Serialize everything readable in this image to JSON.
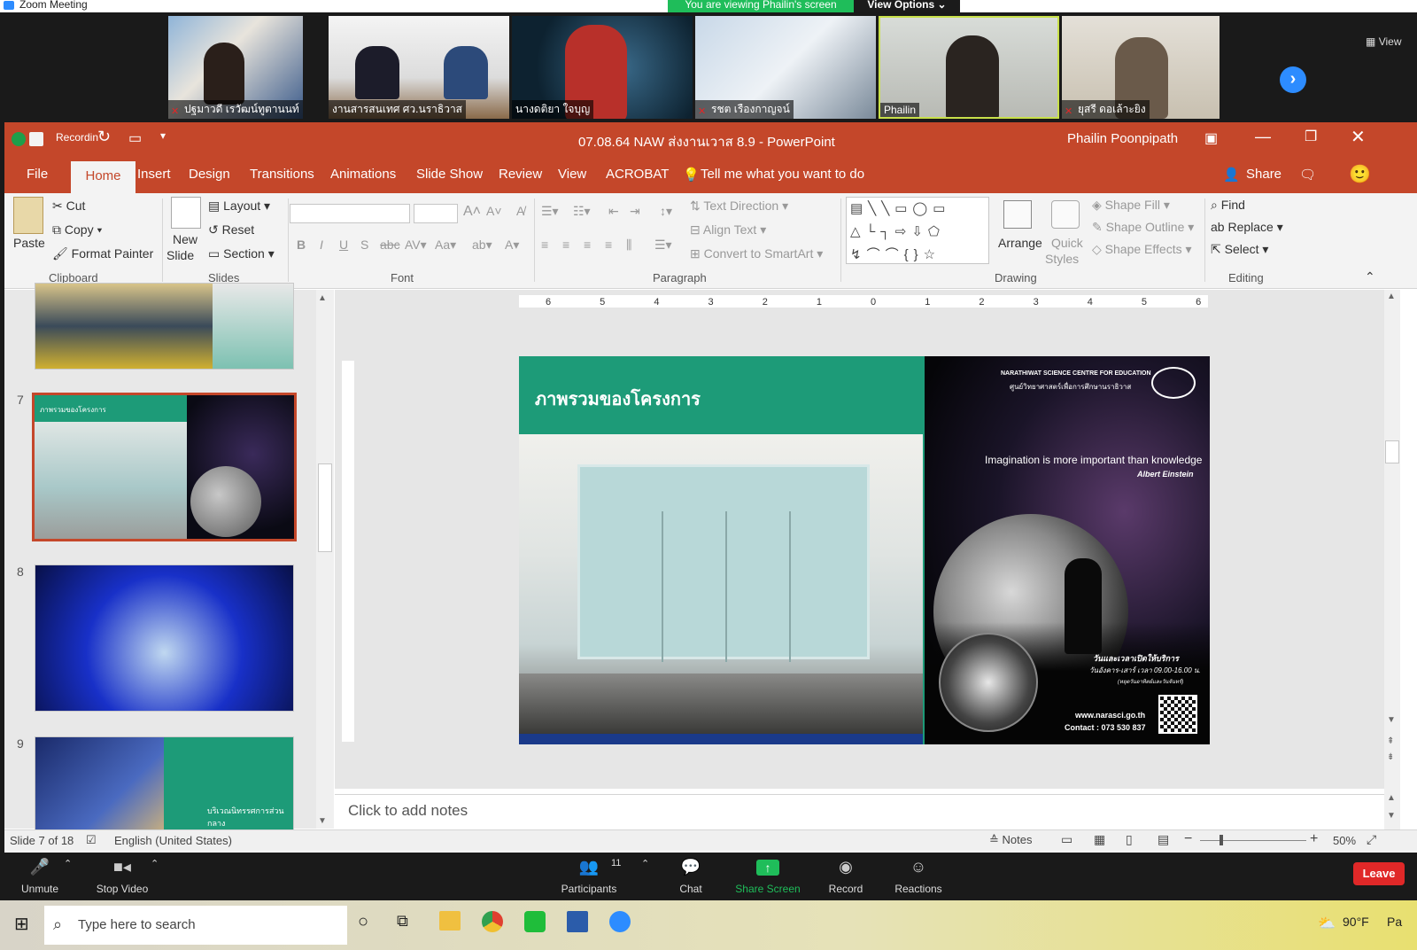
{
  "zoom": {
    "window_title": "Zoom Meeting",
    "viewing_banner": "You are viewing Phailin's screen",
    "view_options": "View Options",
    "view_label": "View",
    "participants": [
      {
        "name": "ปฐมาวดี เรวัฒน์ทูตานนท์",
        "muted": true
      },
      {
        "name": "งานสารสนเทศ ศว.นราธิวาส",
        "muted": false
      },
      {
        "name": "นางดติยา ใจบุญ",
        "muted": false
      },
      {
        "name": "รชต เรืองกาญจน์",
        "muted": true
      },
      {
        "name": "Phailin",
        "muted": false
      },
      {
        "name": "ยุสรี ดอเล้าะยิง",
        "muted": true
      }
    ],
    "controls": {
      "unmute": "Unmute",
      "stop_video": "Stop Video",
      "participants": "Participants",
      "participants_count": "11",
      "chat": "Chat",
      "share_screen": "Share Screen",
      "record": "Record",
      "reactions": "Reactions",
      "leave": "Leave"
    }
  },
  "ppt": {
    "recording_label": "Recordin",
    "title": "07.08.64 NAW ส่งงานเวาส 8.9 - PowerPoint",
    "user": "Phailin Poonpipath",
    "tabs": [
      "File",
      "Home",
      "Insert",
      "Design",
      "Transitions",
      "Animations",
      "Slide Show",
      "Review",
      "View",
      "ACROBAT"
    ],
    "tell_me": "Tell me what you want to do",
    "share": "Share",
    "ribbon": {
      "paste": "Paste",
      "cut": "Cut",
      "copy": "Copy",
      "format_painter": "Format Painter",
      "clipboard": "Clipboard",
      "new_slide_1": "New",
      "new_slide_2": "Slide",
      "layout": "Layout",
      "reset": "Reset",
      "section": "Section",
      "slides": "Slides",
      "font": "Font",
      "paragraph": "Paragraph",
      "text_direction": "Text Direction",
      "align_text": "Align Text",
      "convert_smartart": "Convert to SmartArt",
      "arrange": "Arrange",
      "quick_styles_1": "Quick",
      "quick_styles_2": "Styles",
      "shape_fill": "Shape Fill",
      "shape_outline": "Shape Outline",
      "shape_effects": "Shape Effects",
      "drawing": "Drawing",
      "find": "Find",
      "replace": "Replace",
      "select": "Select",
      "editing": "Editing"
    },
    "thumbnails": {
      "slide7_num": "7",
      "slide8_num": "8",
      "slide9_num": "9",
      "slide7_title": "ภาพรวมของโครงการ",
      "slide9_text": "บริเวณนิทรรศการส่วนกลาง"
    },
    "slide": {
      "title": "ภาพรวมของโครงการ",
      "org_en": "NARATHIWAT SCIENCE CENTRE FOR EDUCATION",
      "org_th": "ศูนย์วิทยาศาสตร์เพื่อการศึกษานราธิวาส",
      "quote": "Imagination is more important than knowledge",
      "author": "Albert Einstein",
      "hours_title": "วันและเวลาเปิดให้บริการ",
      "hours": "วันอังคาร-เสาร์ เวลา 09.00-16.00 น.",
      "holiday": "(หยุดวันอาทิตย์และวันจันทร์)",
      "website": "www.narasci.go.th",
      "contact": "Contact : 073 530 837"
    },
    "notes_placeholder": "Click to add notes",
    "status": {
      "slide_info": "Slide 7 of 18",
      "language": "English (United States)",
      "notes": "Notes",
      "zoom": "50%"
    }
  },
  "taskbar": {
    "search_placeholder": "Type here to search",
    "weather": "90°F",
    "weather_suffix": "Pa"
  }
}
